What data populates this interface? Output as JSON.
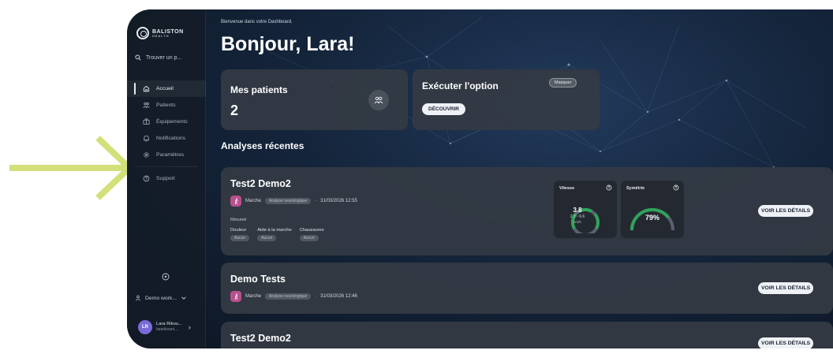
{
  "brand": {
    "name": "BALISTON",
    "tagline": "HEALTH"
  },
  "search": {
    "label": "Trouver un p..."
  },
  "nav": {
    "items": [
      {
        "label": "Accueil",
        "icon": "home-icon",
        "active": true
      },
      {
        "label": "Patients",
        "icon": "users-icon"
      },
      {
        "label": "Équipements",
        "icon": "device-icon"
      },
      {
        "label": "Notifications",
        "icon": "bell-icon"
      },
      {
        "label": "Paramètres",
        "icon": "gear-icon"
      },
      {
        "label": "Support",
        "icon": "help-circle-icon"
      }
    ]
  },
  "workspace": {
    "label": "Demo work..."
  },
  "user": {
    "initials": "LR",
    "name": "Lara Rikou...",
    "email": "lararikouni..."
  },
  "header": {
    "welcome": "Bienvenue dans votre Dashboard.",
    "greeting": "Bonjour, Lara!"
  },
  "patients_card": {
    "label": "Mes patients",
    "count": "2"
  },
  "exec_card": {
    "label": "Exécuter l'option",
    "hide_label": "Masquer",
    "discover_label": "DÉCOUVRIR"
  },
  "analyses": {
    "title": "Analyses récentes",
    "details_label": "VOIR LES DÉTAILS",
    "items": [
      {
        "name": "Test2 Demo2",
        "activity": "Marche",
        "tag": "Analyse neurologique",
        "datetime": "31/03/2026 12:55",
        "summary_label": "Résumé",
        "symptoms": [
          {
            "label": "Douleur",
            "value": "Aucun"
          },
          {
            "label": "Aide à la marche",
            "value": "Aucun"
          },
          {
            "label": "Chaussures",
            "value": "Aucun"
          }
        ],
        "speed": {
          "label": "Vitesse",
          "value": "3.8",
          "range": "2.7 - 6.6",
          "unit": "km/h"
        },
        "symmetry": {
          "label": "Symétrie",
          "value": "79%",
          "fraction": 0.79
        }
      },
      {
        "name": "Demo Tests",
        "activity": "Marche",
        "tag": "Analyse neurologique",
        "datetime": "31/03/2026 12:46"
      },
      {
        "name": "Test2 Demo2"
      }
    ]
  },
  "colors": {
    "accent_arrow": "#d3e07a",
    "gauge_green": "#2fa45a",
    "walk_badge": "#b8508e"
  }
}
